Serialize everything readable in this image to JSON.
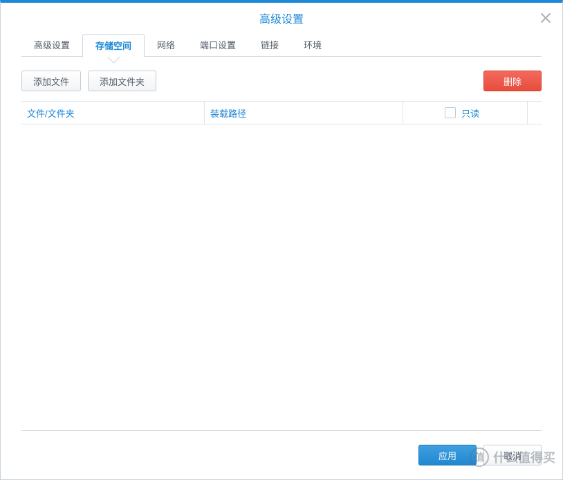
{
  "dialog": {
    "title": "高级设置"
  },
  "tabs": [
    {
      "label": "高级设置",
      "active": false
    },
    {
      "label": "存储空间",
      "active": true
    },
    {
      "label": "网络",
      "active": false
    },
    {
      "label": "端口设置",
      "active": false
    },
    {
      "label": "链接",
      "active": false
    },
    {
      "label": "环境",
      "active": false
    }
  ],
  "toolbar": {
    "add_file": "添加文件",
    "add_folder": "添加文件夹",
    "delete": "删除"
  },
  "table": {
    "headers": {
      "file_folder": "文件/文件夹",
      "mount_path": "装载路径",
      "readonly": "只读"
    },
    "rows": []
  },
  "footer": {
    "apply": "应用",
    "cancel": "取消"
  },
  "watermark": {
    "badge": "值",
    "text": "什么值得买"
  }
}
